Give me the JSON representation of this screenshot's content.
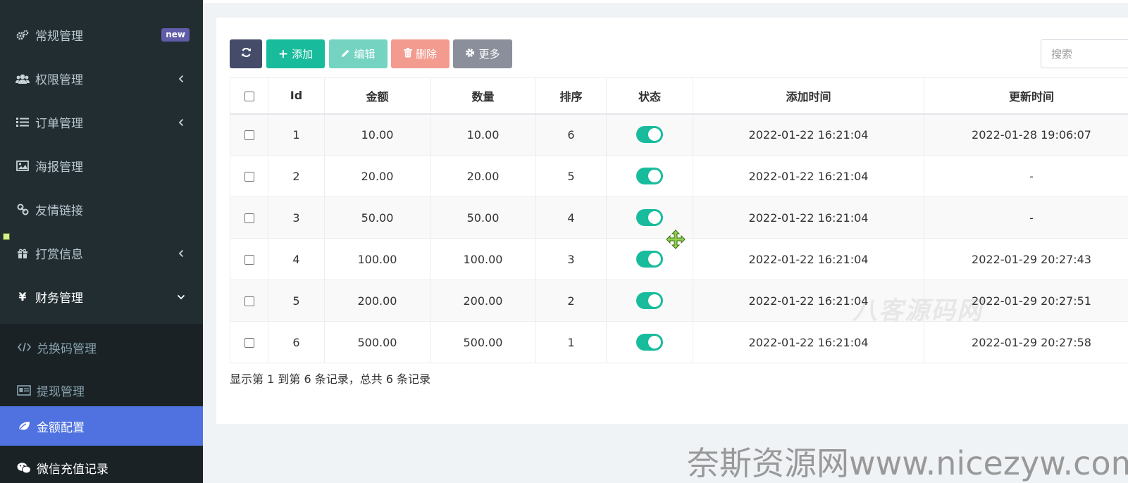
{
  "sidebar": {
    "items": [
      {
        "label": "常规管理",
        "icon": "cogs-icon",
        "badge": "new"
      },
      {
        "label": "权限管理",
        "icon": "users-icon",
        "chevron": "left"
      },
      {
        "label": "订单管理",
        "icon": "list-icon",
        "chevron": "left"
      },
      {
        "label": "海报管理",
        "icon": "image-icon"
      },
      {
        "label": "友情链接",
        "icon": "link-icon"
      },
      {
        "label": "打赏信息",
        "icon": "gift-icon",
        "chevron": "left"
      },
      {
        "label": "财务管理",
        "icon": "yen-icon",
        "chevron": "down"
      }
    ],
    "submenu": [
      {
        "label": "兑换码管理",
        "icon": "code-icon"
      },
      {
        "label": "提现管理",
        "icon": "id-card-icon"
      },
      {
        "label": "金额配置",
        "icon": "leaf-icon",
        "active": true
      },
      {
        "label": "微信充值记录",
        "icon": "wechat-icon"
      }
    ]
  },
  "toolbar": {
    "refresh_icon": "refresh-icon",
    "add_label": "添加",
    "edit_label": "编辑",
    "delete_label": "删除",
    "more_label": "更多",
    "search_placeholder": "搜索"
  },
  "table": {
    "headers": [
      "Id",
      "金额",
      "数量",
      "排序",
      "状态",
      "添加时间",
      "更新时间"
    ],
    "rows": [
      {
        "id": "1",
        "amount": "10.00",
        "quantity": "10.00",
        "sort": "6",
        "status": true,
        "created": "2022-01-22 16:21:04",
        "updated": "2022-01-28 19:06:07"
      },
      {
        "id": "2",
        "amount": "20.00",
        "quantity": "20.00",
        "sort": "5",
        "status": true,
        "created": "2022-01-22 16:21:04",
        "updated": "-"
      },
      {
        "id": "3",
        "amount": "50.00",
        "quantity": "50.00",
        "sort": "4",
        "status": true,
        "created": "2022-01-22 16:21:04",
        "updated": "-"
      },
      {
        "id": "4",
        "amount": "100.00",
        "quantity": "100.00",
        "sort": "3",
        "status": true,
        "created": "2022-01-22 16:21:04",
        "updated": "2022-01-29 20:27:43"
      },
      {
        "id": "5",
        "amount": "200.00",
        "quantity": "200.00",
        "sort": "2",
        "status": true,
        "created": "2022-01-22 16:21:04",
        "updated": "2022-01-29 20:27:51"
      },
      {
        "id": "6",
        "amount": "500.00",
        "quantity": "500.00",
        "sort": "1",
        "status": true,
        "created": "2022-01-22 16:21:04",
        "updated": "2022-01-29 20:27:58"
      }
    ],
    "summary": "显示第 1 到第 6 条记录，总共 6 条记录"
  },
  "watermarks": {
    "overlay": "八客源码网",
    "footer": "奈斯资源网www.nicezyw.com"
  },
  "colors": {
    "sidebar_bg": "#222d32",
    "active_item": "#4f72e0",
    "primary_green": "#18bc9c",
    "badge_purple": "#605ca8"
  }
}
